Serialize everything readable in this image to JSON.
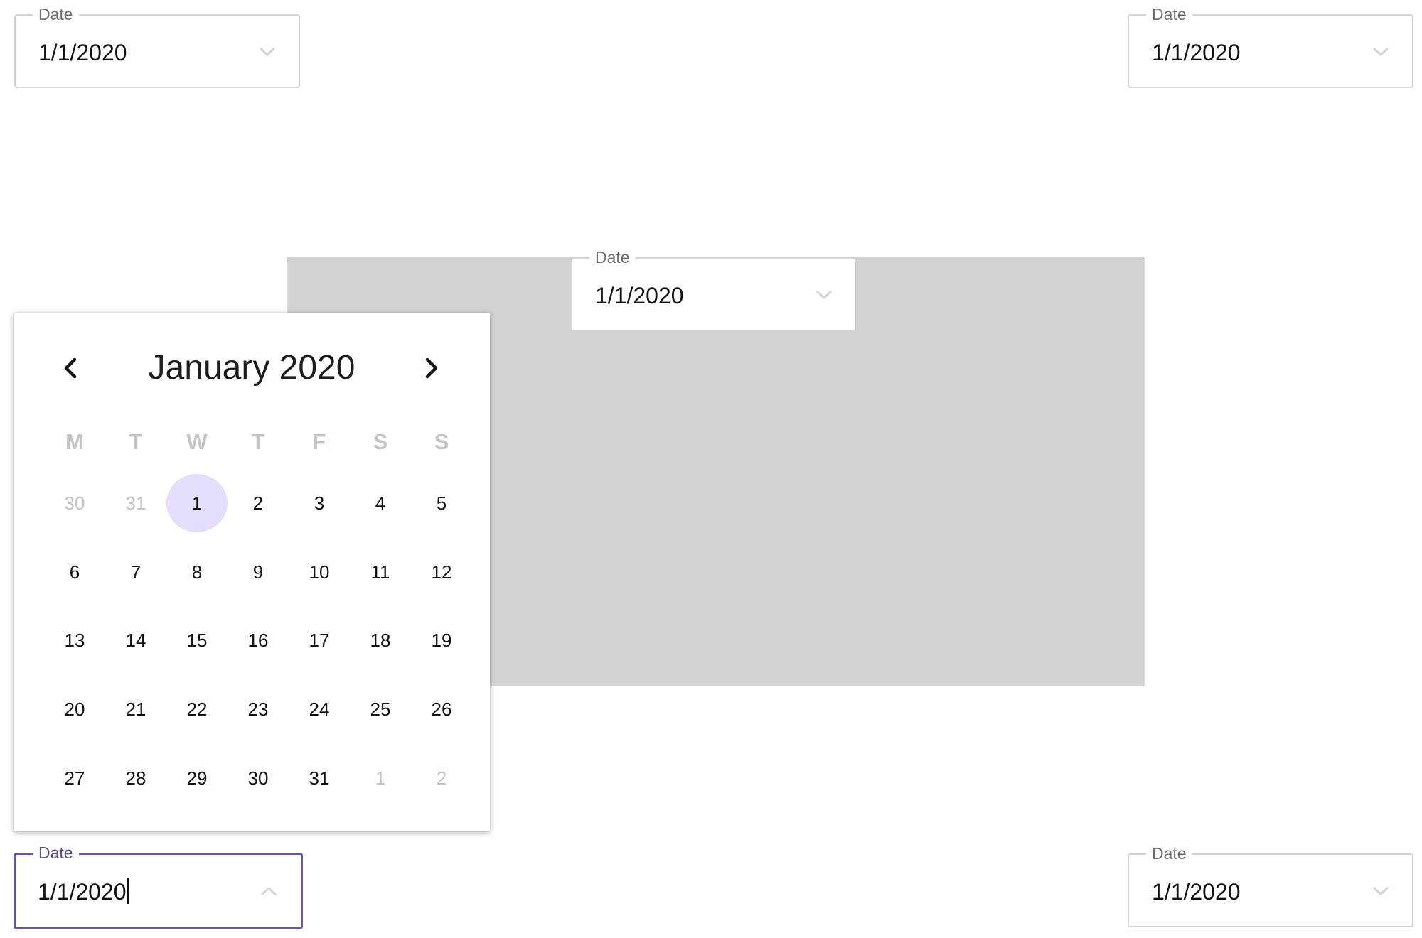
{
  "fields": {
    "top_left": {
      "label": "Date",
      "value": "1/1/2020",
      "icon": "chevron-down-icon"
    },
    "top_right": {
      "label": "Date",
      "value": "1/1/2020",
      "icon": "chevron-down-icon"
    },
    "center": {
      "label": "Date",
      "value": "1/1/2020",
      "icon": "chevron-down-icon"
    },
    "bottom_left": {
      "label": "Date",
      "value": "1/1/2020",
      "icon": "chevron-up-icon",
      "focused": true
    },
    "bottom_right": {
      "label": "Date",
      "value": "1/1/2020",
      "icon": "chevron-down-icon"
    }
  },
  "calendar": {
    "title": "January 2020",
    "prev_icon": "chevron-left-icon",
    "next_icon": "chevron-right-icon",
    "weekdays": [
      "M",
      "T",
      "W",
      "T",
      "F",
      "S",
      "S"
    ],
    "weeks": [
      [
        {
          "d": "30",
          "outside": true
        },
        {
          "d": "31",
          "outside": true
        },
        {
          "d": "1",
          "selected": true
        },
        {
          "d": "2"
        },
        {
          "d": "3"
        },
        {
          "d": "4"
        },
        {
          "d": "5"
        }
      ],
      [
        {
          "d": "6"
        },
        {
          "d": "7"
        },
        {
          "d": "8"
        },
        {
          "d": "9"
        },
        {
          "d": "10"
        },
        {
          "d": "11"
        },
        {
          "d": "12"
        }
      ],
      [
        {
          "d": "13"
        },
        {
          "d": "14"
        },
        {
          "d": "15"
        },
        {
          "d": "16"
        },
        {
          "d": "17"
        },
        {
          "d": "18"
        },
        {
          "d": "19"
        }
      ],
      [
        {
          "d": "20"
        },
        {
          "d": "21"
        },
        {
          "d": "22"
        },
        {
          "d": "23"
        },
        {
          "d": "24"
        },
        {
          "d": "25"
        },
        {
          "d": "26"
        }
      ],
      [
        {
          "d": "27"
        },
        {
          "d": "28"
        },
        {
          "d": "29"
        },
        {
          "d": "30"
        },
        {
          "d": "31"
        },
        {
          "d": "1",
          "outside": true
        },
        {
          "d": "2",
          "outside": true
        }
      ]
    ]
  },
  "colors": {
    "accent": "#6a54a8",
    "selected_day_bg": "#e6dcfb",
    "backdrop_panel": "#d3d3d3",
    "muted_text": "#c2c2c6"
  }
}
